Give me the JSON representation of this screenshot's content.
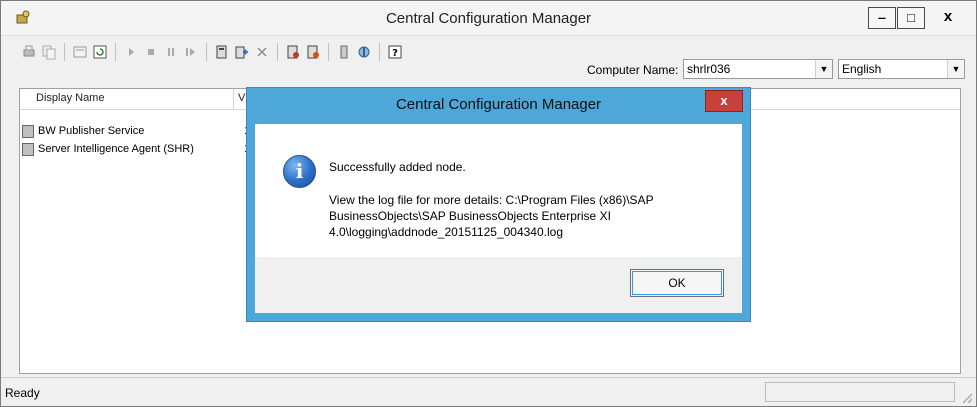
{
  "window": {
    "title": "Central Configuration Manager",
    "minimize_glyph": "‒",
    "maximize_glyph": "□",
    "close_glyph": "x"
  },
  "toolbar": {
    "computer_name_label": "Computer Name:",
    "computer_name_value": "shrlr036",
    "language_value": "English",
    "icons": [
      "print-icon",
      "copy-icon",
      "properties-icon",
      "refresh-icon",
      "start-icon",
      "stop-icon",
      "pause-icon",
      "restart-icon",
      "add-node-icon",
      "add-service-icon",
      "delete-icon",
      "enable-icon",
      "disable-icon",
      "server-icon",
      "network-icon",
      "help-icon"
    ]
  },
  "list": {
    "columns": [
      "Display Name",
      "V"
    ],
    "rows": [
      {
        "name": "BW Publisher Service",
        "extra": "1"
      },
      {
        "name": "Server Intelligence Agent (SHR)",
        "extra": "1"
      }
    ]
  },
  "status": {
    "text": "Ready"
  },
  "dialog": {
    "title": "Central Configuration Manager",
    "close_glyph": "x",
    "message": "Successfully added node.",
    "detail": "View the log file for more details: C:\\Program Files (x86)\\SAP BusinessObjects\\SAP BusinessObjects Enterprise XI 4.0\\logging\\addnode_20151125_004340.log",
    "ok_label": "OK",
    "info_glyph": "i"
  },
  "colors": {
    "dialog_frame": "#4da7d8",
    "close_red": "#c7403a"
  }
}
